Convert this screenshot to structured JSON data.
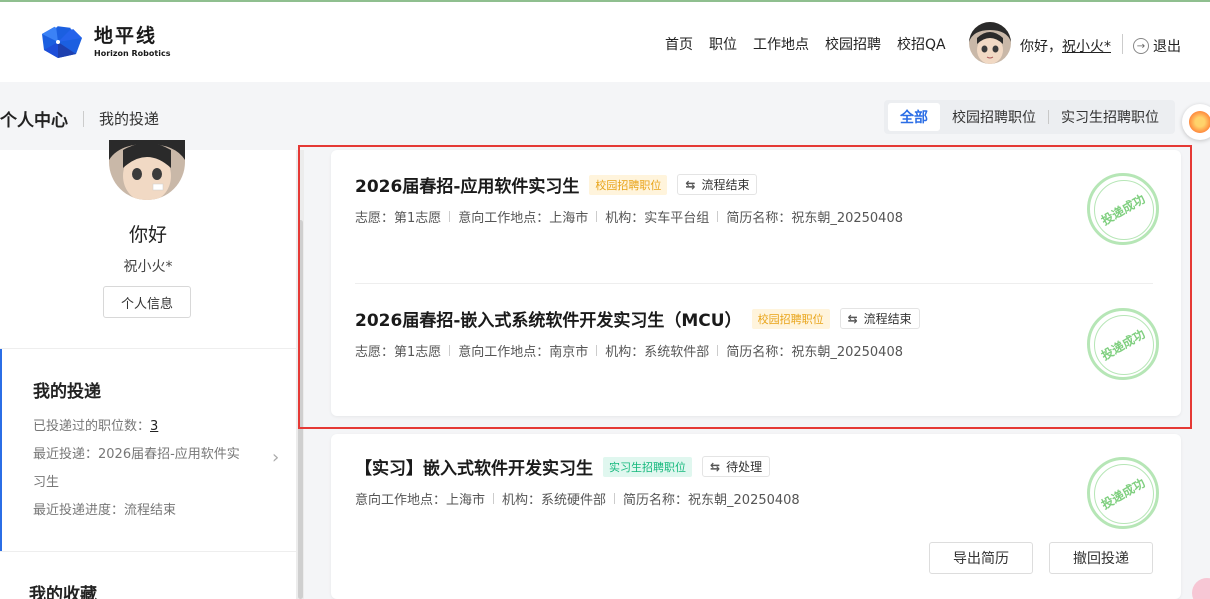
{
  "header": {
    "logo_cn": "地平线",
    "logo_en": "Horizon Robotics",
    "nav": [
      "首页",
      "职位",
      "工作地点",
      "校园招聘",
      "校招QA"
    ],
    "greeting": "你好，",
    "username": "祝小火*",
    "logout": "退出"
  },
  "subheader": {
    "title": "个人中心",
    "page": "我的投递"
  },
  "filter_tabs": [
    "全部",
    "校园招聘职位",
    "实习生招聘职位"
  ],
  "sidebar": {
    "name": "你好",
    "username": "祝小火*",
    "profile_button": "个人信息",
    "my_applications_title": "我的投递",
    "applied_count_label": "已投递过的职位数：",
    "applied_count": "3",
    "recent_label": "最近投递：2026届春招-应用软件实",
    "recent_label_2": "习生",
    "recent_progress": "最近投递进度：流程结束",
    "favorites_title": "我的收藏"
  },
  "applications": [
    {
      "title": "2026届春招-应用软件实习生",
      "tag": "校园招聘职位",
      "status": "流程结束",
      "meta": [
        "志愿：第1志愿",
        "意向工作地点：上海市",
        "机构：实车平台组",
        "简历名称：祝东朝_20250408"
      ],
      "stamp": "投递成功"
    },
    {
      "title": "2026届春招-嵌入式系统软件开发实习生（MCU）",
      "tag": "校园招聘职位",
      "status": "流程结束",
      "meta": [
        "志愿：第1志愿",
        "意向工作地点：南京市",
        "机构：系统软件部",
        "简历名称：祝东朝_20250408"
      ],
      "stamp": "投递成功"
    },
    {
      "title": "【实习】嵌入式软件开发实习生",
      "tag": "实习生招聘职位",
      "status": "待处理",
      "meta": [
        "意向工作地点：上海市",
        "机构：系统硬件部",
        "简历名称：祝东朝_20250408"
      ],
      "stamp": "投递成功",
      "buttons": [
        "导出简历",
        "撤回投递"
      ]
    }
  ],
  "colors": {
    "accent": "#2b6ee6",
    "highlight": "#e53935",
    "stamp": "#7fcf7f"
  }
}
